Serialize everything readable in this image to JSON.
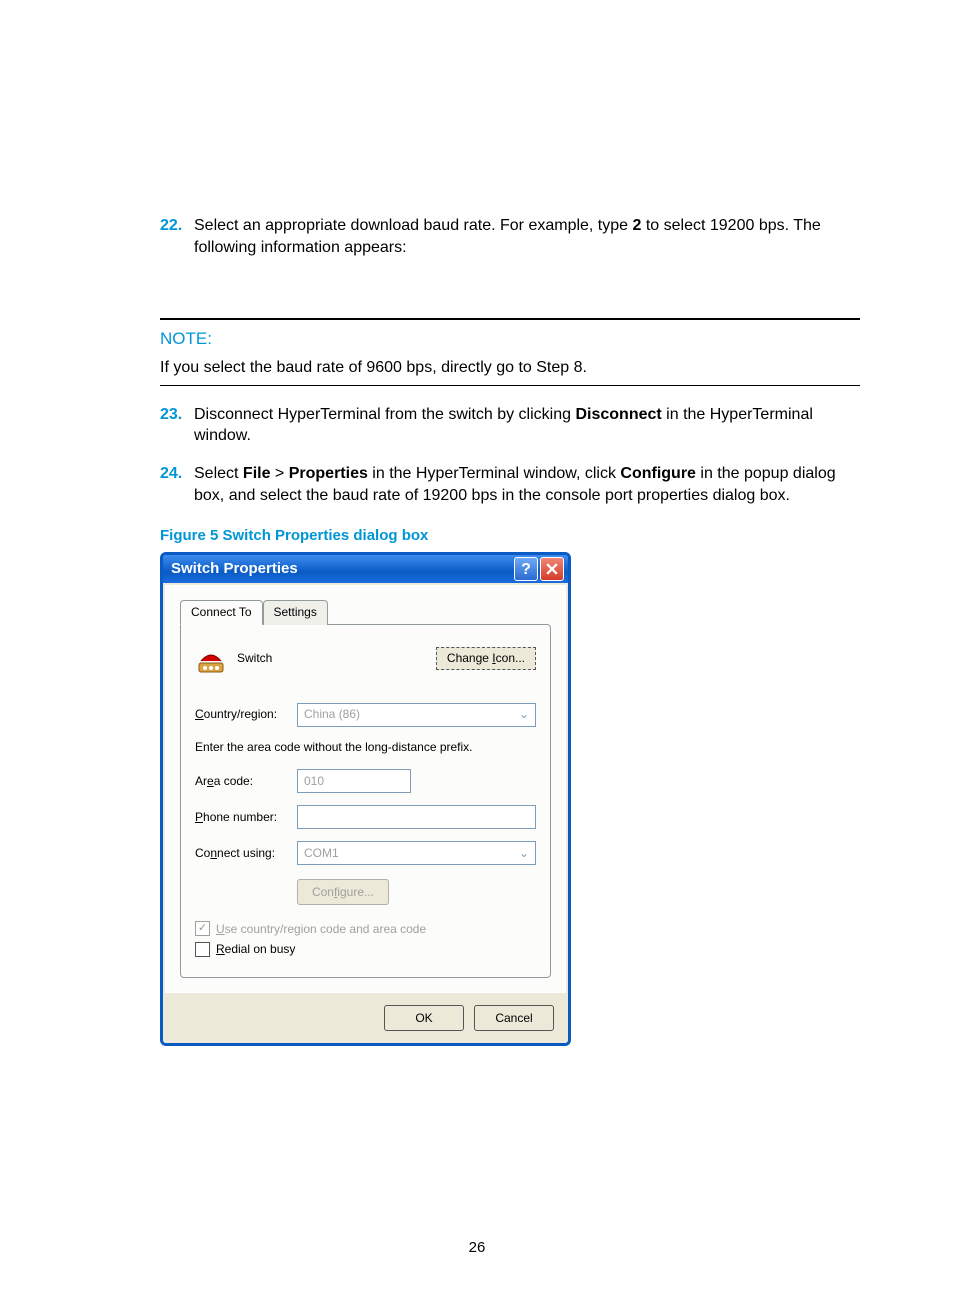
{
  "steps": {
    "s22": {
      "num": "22.",
      "text_a": "Select an appropriate download baud rate. For example, type ",
      "bold_a": "2",
      "text_b": " to select 19200 bps. The following information appears:"
    },
    "s23": {
      "num": "23.",
      "text_a": "Disconnect HyperTerminal from the switch by clicking ",
      "bold_a": "Disconnect",
      "text_b": " in the HyperTerminal window."
    },
    "s24": {
      "num": "24.",
      "text_a": "Select ",
      "bold_a": "File",
      "text_b": " > ",
      "bold_b": "Properties",
      "text_c": " in the HyperTerminal window, click ",
      "bold_c": "Configure",
      "text_d": " in the popup dialog box, and select the baud rate of 19200 bps in the console port properties dialog box."
    }
  },
  "note": {
    "title": "NOTE:",
    "body": "If you select the baud rate of 9600 bps, directly go to Step 8."
  },
  "figure_title": "Figure 5 Switch Properties dialog box",
  "dialog": {
    "title": "Switch Properties",
    "tabs": {
      "t0": "Connect To",
      "t1": "Settings"
    },
    "connection_name": "Switch",
    "change_icon": "Change Icon...",
    "labels": {
      "country": "Country/region:",
      "hint": "Enter the area code without the long-distance prefix.",
      "area": "Area code:",
      "phone": "Phone number:",
      "connect_using": "Connect using:"
    },
    "values": {
      "country": "China (86)",
      "area": "010",
      "phone": "",
      "connect_using": "COM1"
    },
    "configure_btn": "Configure...",
    "checkboxes": {
      "use_country": "Use country/region code and area code",
      "redial": "Redial on busy"
    },
    "ok": "OK",
    "cancel": "Cancel"
  },
  "page_number": "26"
}
